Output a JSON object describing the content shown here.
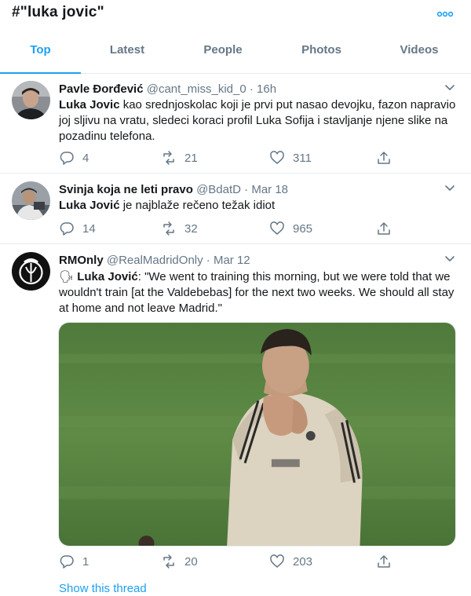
{
  "header": {
    "title": "#\"luka jovic\""
  },
  "tabs": [
    {
      "label": "Top"
    },
    {
      "label": "Latest"
    },
    {
      "label": "People"
    },
    {
      "label": "Photos"
    },
    {
      "label": "Videos"
    }
  ],
  "tweets": [
    {
      "name": "Pavle Đorđević",
      "handle": "@cant_miss_kid_0",
      "dot": "·",
      "time": "16h",
      "bold": "Luka Jovic",
      "body": " kao srednjoskolac koji je prvi put nasao devojku, fazon napravio joj sljivu na vratu, sledeci koraci profil Luka Sofija i stavljanje njene slike na pozadinu telefona.",
      "replies": "4",
      "retweets": "21",
      "likes": "311"
    },
    {
      "name": "Svinja koja ne leti pravo",
      "handle": "@BdatD",
      "dot": "·",
      "time": "Mar 18",
      "bold": "Luka Jović",
      "body": " je najblaže rečeno težak idiot",
      "replies": "14",
      "retweets": "32",
      "likes": "965"
    },
    {
      "name": "RMOnly",
      "handle": "@RealMadridOnly",
      "dot": "·",
      "time": "Mar 12",
      "emoji": "🗣",
      "bold": "Luka Jović",
      "body": ": \"We went to training this morning, but we were told that we wouldn't train [at the Valdebebas] for the next two weeks. We should all stay at home and not leave Madrid.\"",
      "replies": "1",
      "retweets": "20",
      "likes": "203",
      "show_thread": "Show this thread"
    }
  ],
  "colors": {
    "accent": "#1da1f2",
    "secondary_text": "#657786",
    "divider": "#e6ecf0"
  },
  "icons": [
    "more-icon",
    "chevron-down-icon",
    "reply-icon",
    "retweet-icon",
    "like-icon",
    "share-icon",
    "speaking-head-emoji"
  ]
}
